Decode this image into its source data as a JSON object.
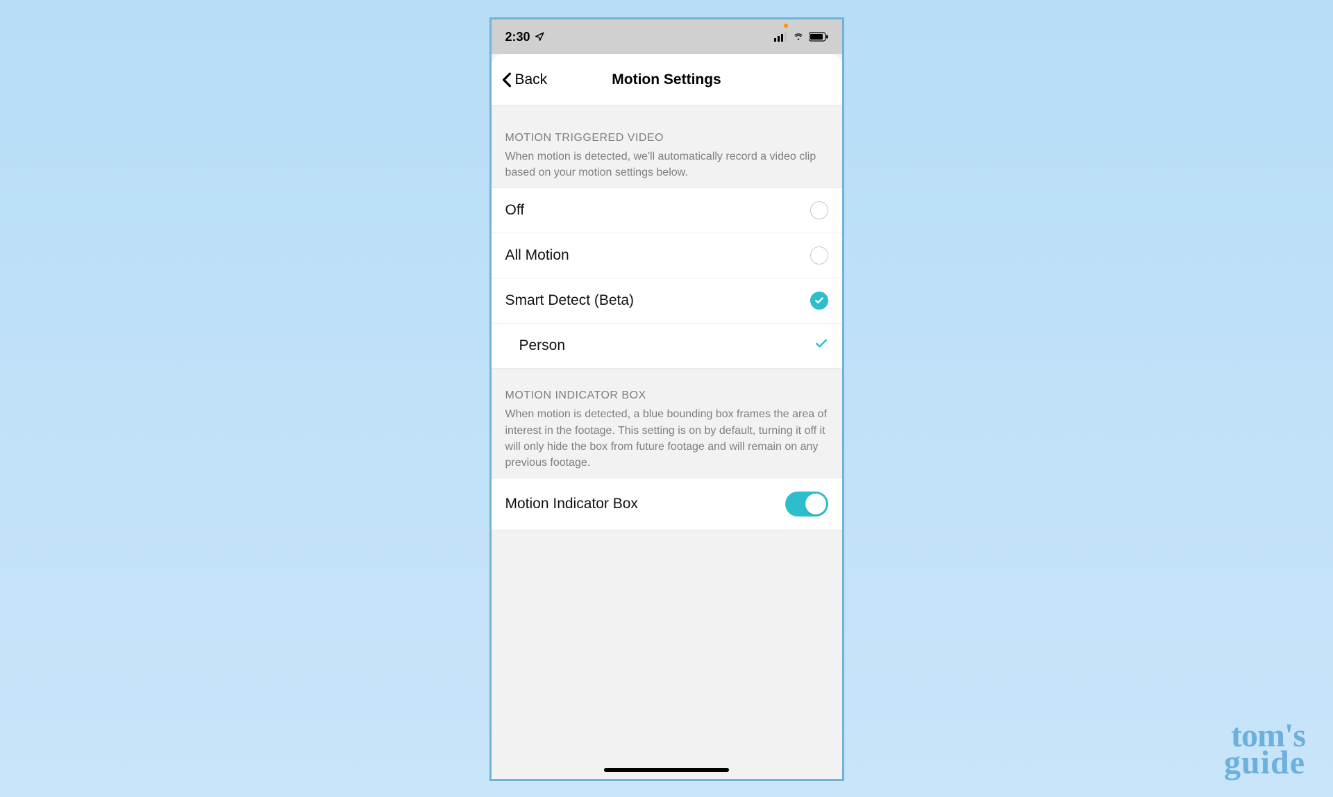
{
  "status": {
    "time": "2:30"
  },
  "nav": {
    "back_label": "Back",
    "title": "Motion Settings"
  },
  "section1": {
    "title": "MOTION TRIGGERED VIDEO",
    "desc": "When motion is detected, we'll automatically record a video clip based on your motion settings below.",
    "options": {
      "off": "Off",
      "all_motion": "All Motion",
      "smart_detect": "Smart Detect (Beta)",
      "sub_person": "Person"
    },
    "selected": "smart_detect"
  },
  "section2": {
    "title": "MOTION INDICATOR BOX",
    "desc": "When motion is detected, a blue bounding box frames the area of interest in the footage. This setting is on by default, turning it off it will only hide the box from future footage and will remain on any previous footage.",
    "toggle_label": "Motion Indicator Box",
    "toggle_on": true
  },
  "watermark": {
    "line1": "tom's",
    "line2": "guide"
  },
  "colors": {
    "accent": "#2dbecd"
  }
}
